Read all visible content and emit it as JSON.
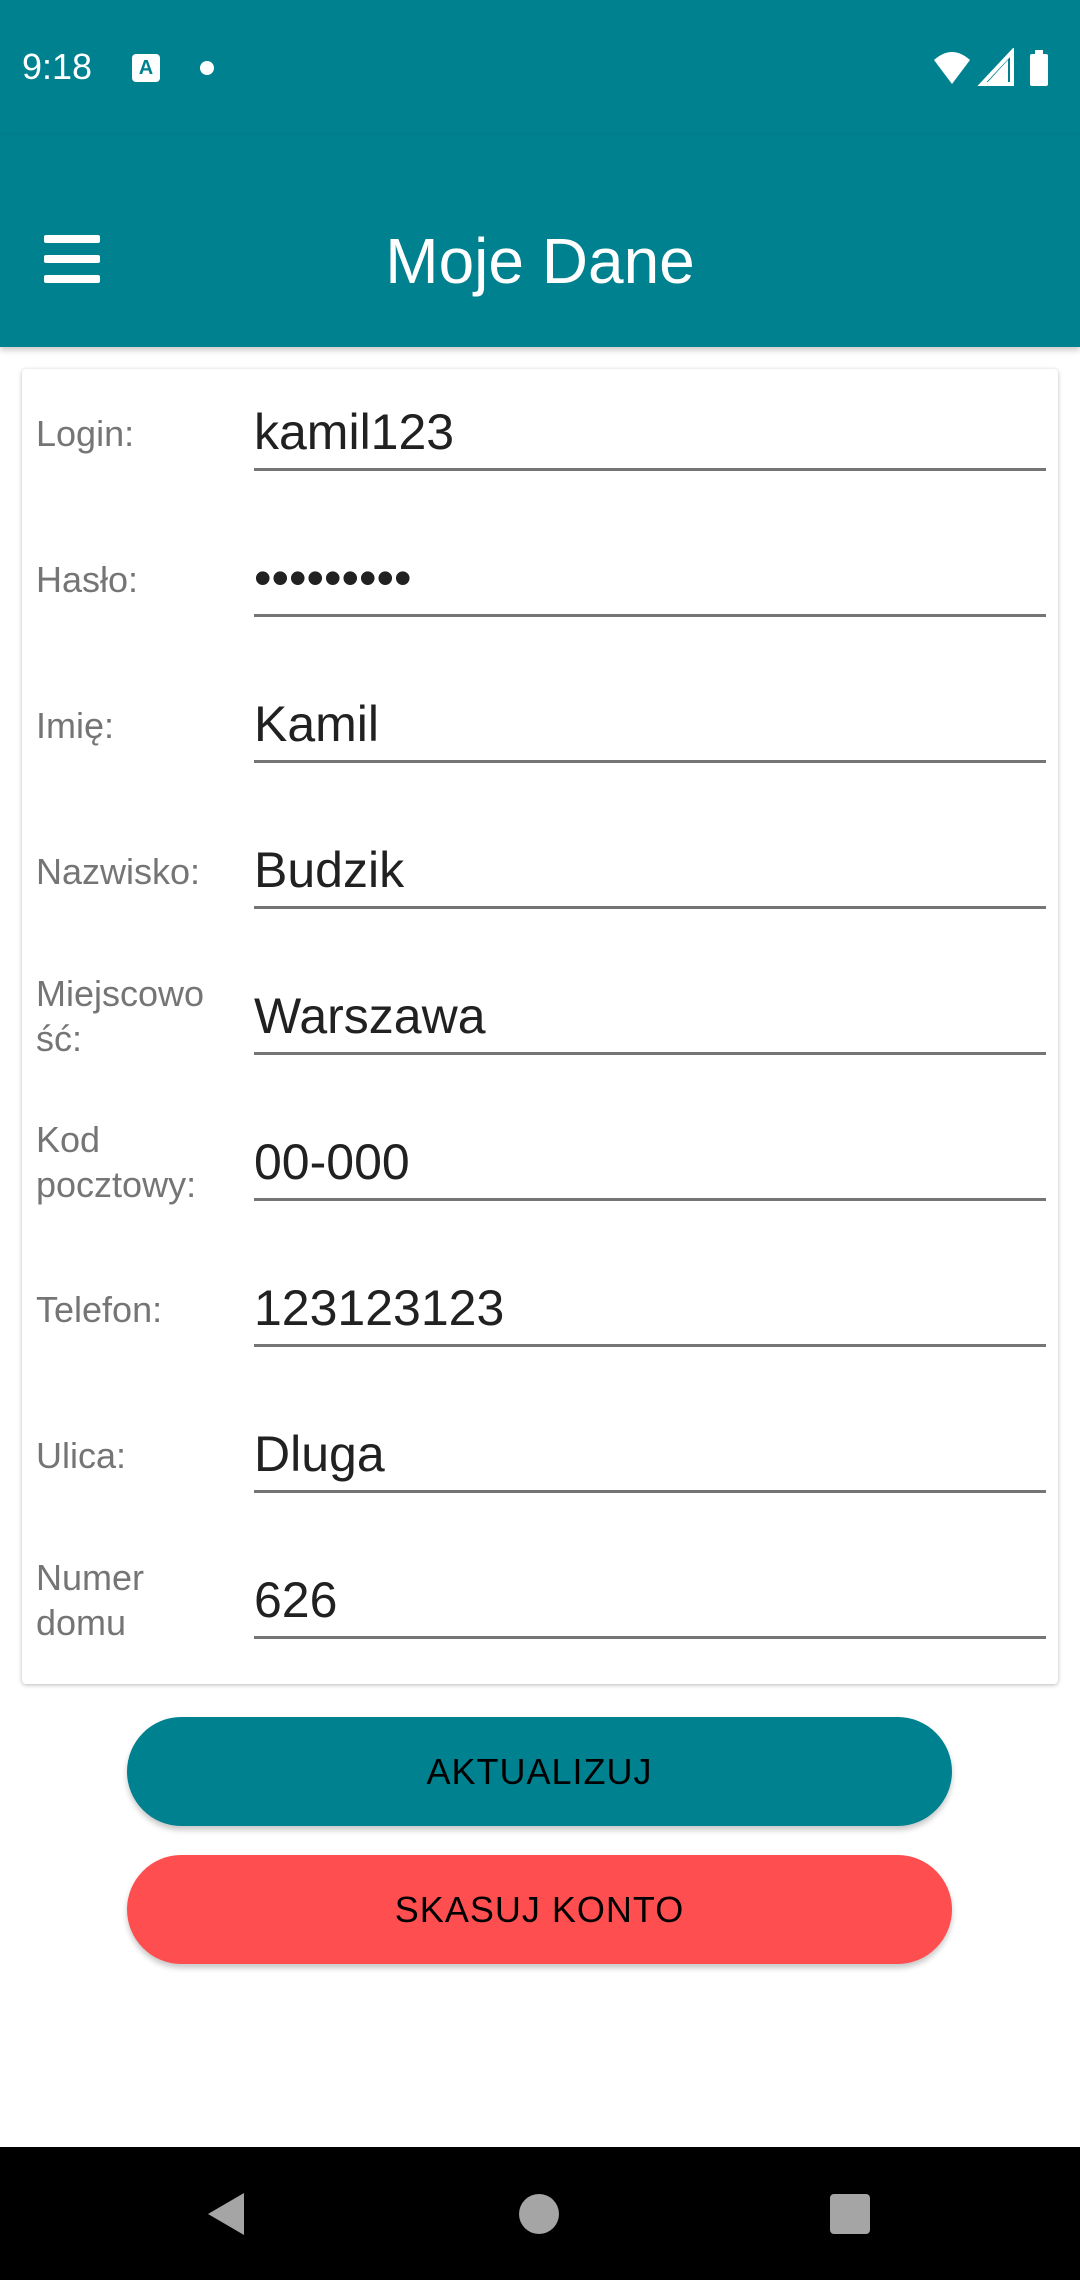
{
  "status_bar": {
    "time": "9:18",
    "icons": [
      "keyboard-a-icon",
      "notification-dot-icon",
      "wifi-icon",
      "signal-icon",
      "battery-icon"
    ]
  },
  "app_bar": {
    "title": "Moje Dane",
    "menu_icon": "hamburger-menu-icon"
  },
  "form": {
    "fields": [
      {
        "label": "Login:",
        "value": "kamil123"
      },
      {
        "label": "Hasło:",
        "value": "•••••••••"
      },
      {
        "label": "Imię:",
        "value": "Kamil"
      },
      {
        "label": "Nazwisko:",
        "value": "Budzik"
      },
      {
        "label": "Miejscowo ść:",
        "value": "Warszawa"
      },
      {
        "label": "Kod pocztowy:",
        "value": "00-000"
      },
      {
        "label": "Telefon:",
        "value": "123123123"
      },
      {
        "label": "Ulica:",
        "value": "Dluga"
      },
      {
        "label": "Numer domu",
        "value": "626"
      }
    ]
  },
  "buttons": {
    "update": "AKTUALIZUJ",
    "delete": "SKASUJ KONTO"
  },
  "colors": {
    "primary": "#00818F",
    "danger": "#FF4E4F",
    "label": "#757575",
    "text": "#212121"
  },
  "nav_bar": {
    "icons": [
      "back-icon",
      "home-icon",
      "recents-icon"
    ]
  }
}
